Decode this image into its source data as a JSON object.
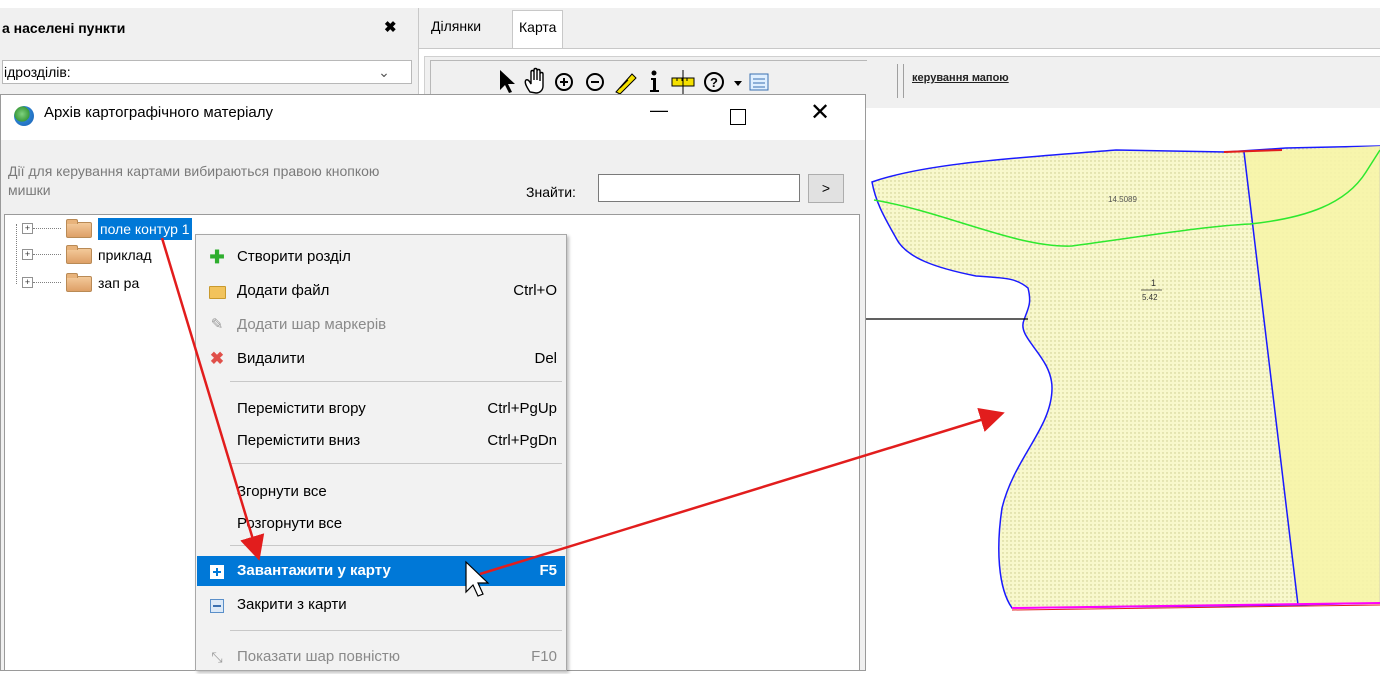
{
  "background_panel": {
    "title": "а населені пункти",
    "close_glyph": "✖",
    "combo_label": "ідрозділів:"
  },
  "tabs": [
    {
      "label": "Ділянки",
      "active": false
    },
    {
      "label": "Карта",
      "active": true
    }
  ],
  "toolbar": {
    "icons": [
      "pointer-icon",
      "pan-hand-icon",
      "zoom-in-icon",
      "zoom-out-icon",
      "measure-icon",
      "info-icon",
      "ruler-icon",
      "help-icon",
      "dropdown-icon",
      "layers-icon"
    ],
    "link_label": "керування мапою"
  },
  "map": {
    "label_area": "14.5089",
    "label_fraction_num": "1",
    "label_fraction_den": "5.42",
    "colors": {
      "fill": "#f7f7c8",
      "boundary": "#1a1aff",
      "green_line": "#2ee82e",
      "bottom_line": "#ff00ff",
      "red_line": "#e21d1d"
    }
  },
  "dialog": {
    "title": "Архів картографічного матеріалу",
    "minimize_glyph": "—",
    "close_glyph": "✕",
    "hint": "Дії для керування картами вибираються правою кнопкою мишки",
    "find_label": "Знайти:",
    "find_value": "",
    "find_button": ">"
  },
  "tree": [
    {
      "label": "поле контур 1",
      "selected": true
    },
    {
      "label": "приклад",
      "selected": false
    },
    {
      "label": "зап ра",
      "selected": false
    }
  ],
  "context_menu": {
    "items": [
      {
        "label": "Створити розділ",
        "shortcut": "",
        "icon": "plus-green-icon",
        "enabled": true
      },
      {
        "label": "Додати файл",
        "shortcut": "Ctrl+O",
        "icon": "folder-icon",
        "enabled": true
      },
      {
        "label": "Додати шар маркерів",
        "shortcut": "",
        "icon": "pencil-icon",
        "enabled": false
      },
      {
        "label": "Видалити",
        "shortcut": "Del",
        "icon": "delete-x-icon",
        "enabled": true
      },
      {
        "label": "Перемістити вгору",
        "shortcut": "Ctrl+PgUp",
        "icon": "",
        "enabled": true
      },
      {
        "label": "Перемістити вниз",
        "shortcut": "Ctrl+PgDn",
        "icon": "",
        "enabled": true
      },
      {
        "label": "Згорнути все",
        "shortcut": "",
        "icon": "",
        "enabled": true
      },
      {
        "label": "Розгорнути все",
        "shortcut": "",
        "icon": "",
        "enabled": true
      },
      {
        "label": "Завантажити у карту",
        "shortcut": "F5",
        "icon": "expand-square-icon",
        "enabled": true,
        "highlighted": true
      },
      {
        "label": "Закрити з карти",
        "shortcut": "",
        "icon": "collapse-square-icon",
        "enabled": true
      },
      {
        "label": "Показати шар повністю",
        "shortcut": "F10",
        "icon": "fit-extent-icon",
        "enabled": false
      }
    ]
  },
  "annotation_arrows": {
    "color": "#e21d1d"
  }
}
